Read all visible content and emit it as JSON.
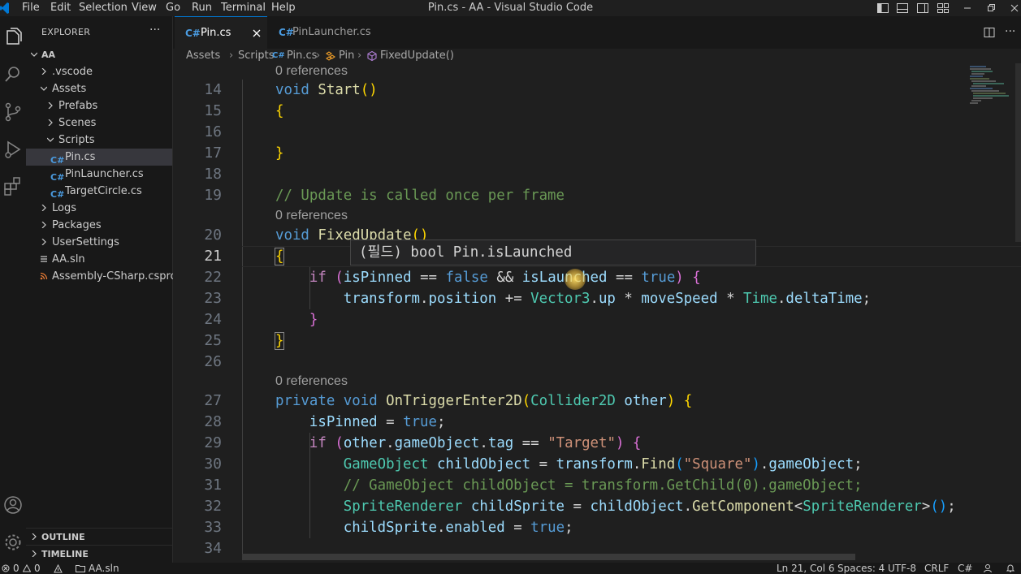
{
  "titlebar": {
    "menus": [
      "File",
      "Edit",
      "Selection",
      "View",
      "Go",
      "Run",
      "Terminal",
      "Help"
    ],
    "title": "Pin.cs - AA - Visual Studio Code"
  },
  "explorer": {
    "title": "EXPLORER",
    "more": "···",
    "root": "AA",
    "items": [
      {
        "label": ".vscode"
      },
      {
        "label": "Assets"
      },
      {
        "label": "Prefabs"
      },
      {
        "label": "Scenes"
      },
      {
        "label": "Scripts"
      },
      {
        "label": "Pin.cs"
      },
      {
        "label": "PinLauncher.cs"
      },
      {
        "label": "TargetCircle.cs"
      },
      {
        "label": "Logs"
      },
      {
        "label": "Packages"
      },
      {
        "label": "UserSettings"
      },
      {
        "label": "AA.sln"
      },
      {
        "label": "Assembly-CSharp.csproj"
      }
    ],
    "outline": "OUTLINE",
    "timeline": "TIMELINE"
  },
  "tabs": {
    "active": "Pin.cs",
    "inactive": "PinLauncher.cs",
    "cs_glyph": "C#"
  },
  "breadcrumb": {
    "parts": [
      "Assets",
      "Scripts",
      "Pin.cs",
      "Pin",
      "FixedUpdate()"
    ]
  },
  "editor": {
    "lens": "0 references",
    "line_numbers": [
      "14",
      "15",
      "16",
      "17",
      "18",
      "19",
      "20",
      "21",
      "22",
      "23",
      "24",
      "25",
      "26",
      "27",
      "28",
      "29",
      "30",
      "31",
      "32",
      "33",
      "34"
    ],
    "current_line": "21",
    "comment_update": "// Update is called once per frame",
    "comment_getchild": "// GameObject childObject = transform.GetChild(0).gameObject;",
    "string_target": "\"Target\"",
    "string_square": "\"Square\"",
    "hover_text": "(필드) bool Pin.isLaunched"
  },
  "statusbar": {
    "errors": "0",
    "warnings": "0",
    "solution": "AA.sln",
    "position": "Ln 21, Col 6",
    "spaces": "Spaces: 4",
    "encoding": "UTF-8",
    "eol": "CRLF",
    "language": "C#"
  },
  "colors": {
    "accent": "#0078d4",
    "keyword": "#569cd6",
    "type": "#4ec9b0",
    "function": "#dcdcaa",
    "variable": "#9cdcfe",
    "string": "#ce9178",
    "comment": "#6a9955"
  }
}
